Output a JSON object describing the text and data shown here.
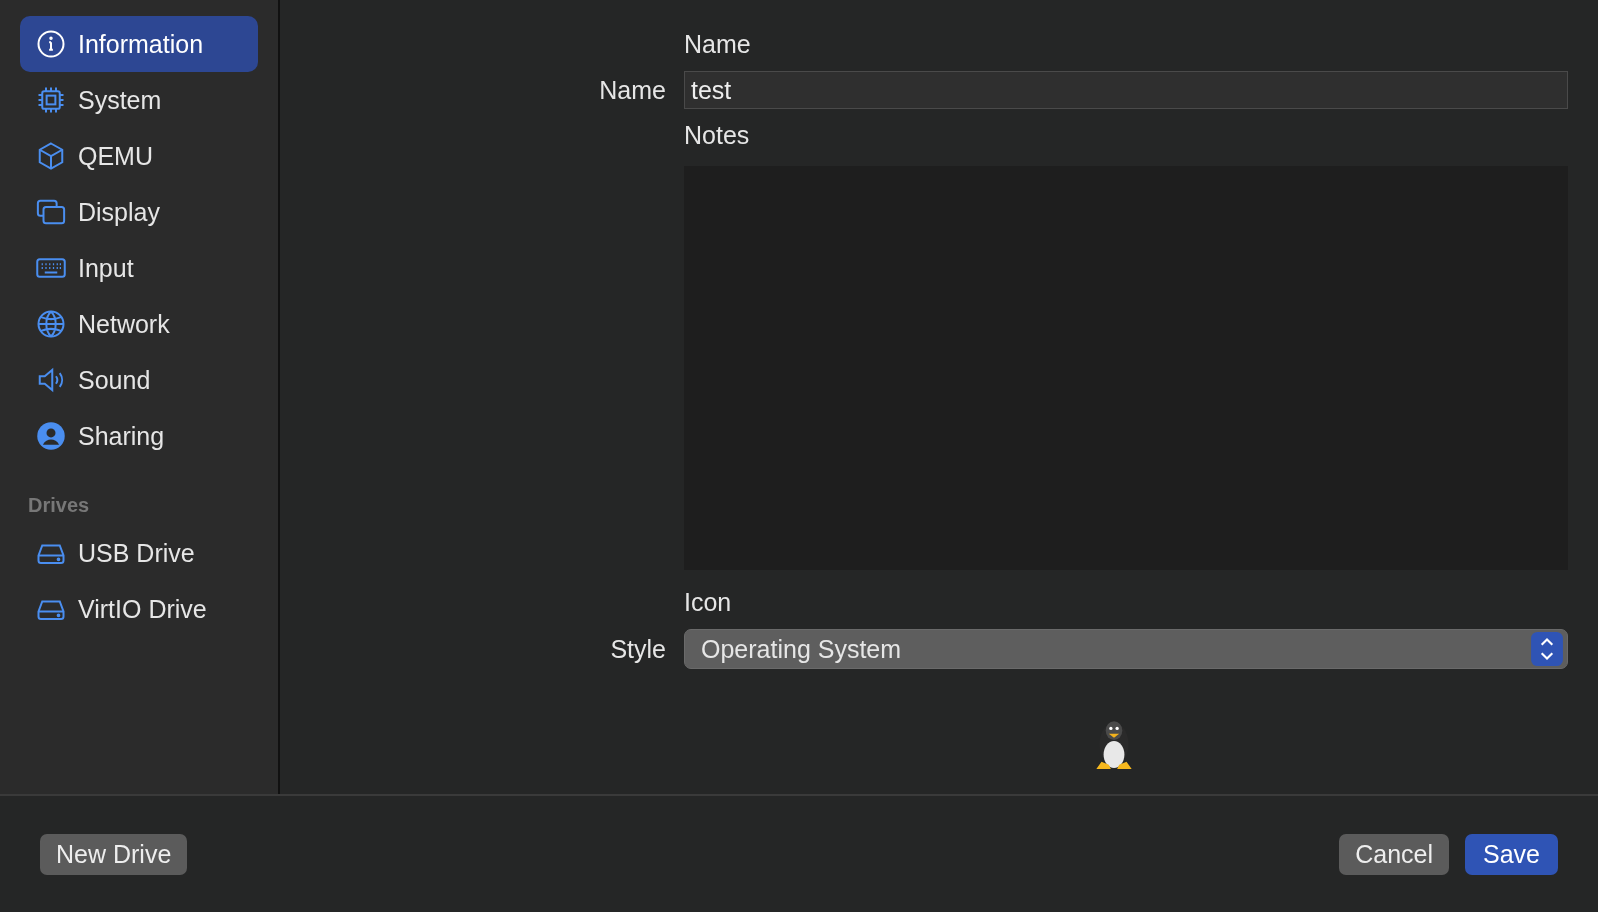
{
  "sidebar": {
    "items": [
      {
        "label": "Information",
        "selected": true
      },
      {
        "label": "System",
        "selected": false
      },
      {
        "label": "QEMU",
        "selected": false
      },
      {
        "label": "Display",
        "selected": false
      },
      {
        "label": "Input",
        "selected": false
      },
      {
        "label": "Network",
        "selected": false
      },
      {
        "label": "Sound",
        "selected": false
      },
      {
        "label": "Sharing",
        "selected": false
      }
    ],
    "drives_heading": "Drives",
    "drives": [
      {
        "label": "USB Drive",
        "selected": false
      },
      {
        "label": "VirtIO Drive",
        "selected": false
      }
    ]
  },
  "form": {
    "name_section": "Name",
    "name_label": "Name",
    "name_value": "test",
    "notes_section": "Notes",
    "icon_section": "Icon",
    "style_label": "Style",
    "style_value": "Operating System"
  },
  "buttons": {
    "new_drive": "New Drive",
    "cancel": "Cancel",
    "save": "Save"
  }
}
